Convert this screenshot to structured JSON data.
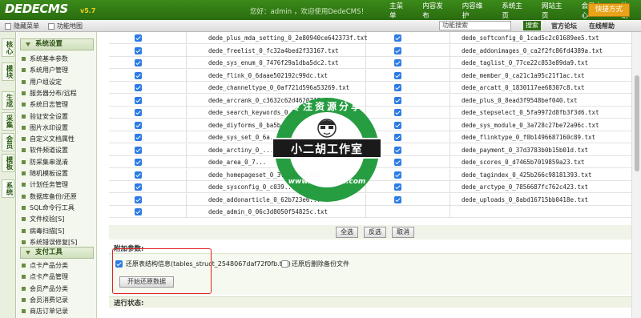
{
  "header": {
    "logo": "DEDECMS",
    "version": "v5.7",
    "welcome": "您好：admin ，欢迎使用DedeCMS！",
    "nav": [
      "主菜单",
      "内容发布",
      "内容维护",
      "系统主页",
      "网站主页",
      "会员中心",
      "注销"
    ],
    "quick_label": "快捷方式"
  },
  "subbar": {
    "hide_menu": "隐藏菜单",
    "site_map": "功能地图",
    "search_placeholder": "功能搜索",
    "search_btn": "搜索",
    "forum": "官方论坛",
    "online_help": "在线帮助"
  },
  "vtabs": [
    "核心",
    "模块",
    "生成",
    "采集",
    "会员",
    "模板",
    "系统"
  ],
  "menu": {
    "section1": "系统设置",
    "items1": [
      "系统基本参数",
      "系统用户管理",
      "用户组设定",
      "服务器分布/远程",
      "系统日志管理",
      "验证安全设置",
      "图片水印设置",
      "自定义文档属性",
      "软件频道设置",
      "防采集串混淆",
      "随机模板设置",
      "计划任务管理",
      "数据库备份/还原",
      "SQL命令行工具",
      "文件校验[S]",
      "病毒扫描[S]",
      "系统错误修复[S]"
    ],
    "section2": "支付工具",
    "items2": [
      "点卡产品分类",
      "点卡产品管理",
      "会员产品分类",
      "会员消费记录",
      "商店订单记录"
    ]
  },
  "files": [
    [
      "dede_plus_mda_setting_0_2e80940ce642373f.txt",
      "dede_softconfig_0_1cad5c2c01689ee5.txt"
    ],
    [
      "dede_freelist_0_fc32a4bed2f33167.txt",
      "dede_addonimages_0_ca2f2fc86fd4389a.txt"
    ],
    [
      "dede_sys_enum_0_7476f29a1dba5dc2.txt",
      "dede_taglist_0_77ce22c853e89da9.txt"
    ],
    [
      "dede_flink_0_6daae502192c99dc.txt",
      "dede_member_0_ca21c1a95c21f1ac.txt"
    ],
    [
      "dede_channeltype_0_0af721d596a53269.txt",
      "dede_arcatt_0_1830117ee68307c8.txt"
    ],
    [
      "dede_arcrank_0_c3632c62d4620719.txt",
      "dede_plus_0_8ead3f9548bef040.txt"
    ],
    [
      "dede_search_keywords_0_6f43...",
      "dede_stepselect_0_5fa9972d8fb3f3d6.txt"
    ],
    [
      "dede_diyforms_0_ba5b...",
      "dede_sys_module_0_3a728c27be72a96c.txt"
    ],
    [
      "dede_sys_set_0_6a...f97f72.txt",
      "dede_flinktype_0_f0b1496687160c89.txt"
    ],
    [
      "dede_arctiny_0_...",
      "dede_payment_0_37d3783b0b15b01d.txt"
    ],
    [
      "dede_area_0_7...",
      "dede_scores_0_d7465b7019859a23.txt"
    ],
    [
      "dede_homepageset_0_3...0278.txt",
      "dede_tagindex_0_425b266c98181393.txt"
    ],
    [
      "dede_sysconfig_0_c039...",
      "dede_arctype_0_7856687fc762c423.txt"
    ],
    [
      "dede_addonarticle_0_62b723e6...",
      "dede_uploads_0_8abd16715bb0418e.txt"
    ],
    [
      "dede_admin_0_06c3d8050f54825c.txt",
      ""
    ]
  ],
  "buttons": {
    "select_all": "全选",
    "invert": "反选",
    "cancel": "取消"
  },
  "attach": {
    "title": "附加参数:",
    "opt1": "还原表结构信息(tables_struct_2548067daf72f0fb.txt)",
    "opt2": "还原后删除备份文件",
    "start": "开始还原数据"
  },
  "progress_title": "进行状态:",
  "watermark": {
    "top": "专注资源分享",
    "band": "小二胡工作室",
    "bottom": "www.xiaoerhu.com"
  }
}
